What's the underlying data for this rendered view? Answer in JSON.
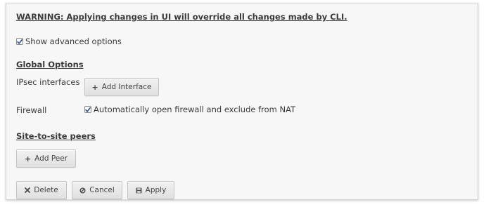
{
  "warning": "WARNING: Applying changes in UI will override all changes made by CLI.",
  "show_advanced": {
    "label": "Show advanced options",
    "checked": true
  },
  "global_options": {
    "title": "Global Options",
    "ipsec_label": "IPsec interfaces",
    "add_interface_label": "Add Interface",
    "firewall_label": "Firewall",
    "firewall_option": {
      "label": "Automatically open firewall and exclude from NAT",
      "checked": true
    }
  },
  "peers": {
    "title": "Site-to-site peers",
    "add_peer_label": "Add Peer"
  },
  "actions": {
    "delete_label": "Delete",
    "cancel_label": "Cancel",
    "apply_label": "Apply"
  },
  "icons": {
    "checkbox": "checkmark-icon",
    "add": "plus-icon",
    "delete": "x-icon",
    "cancel": "ban-icon",
    "apply": "save-icon"
  }
}
